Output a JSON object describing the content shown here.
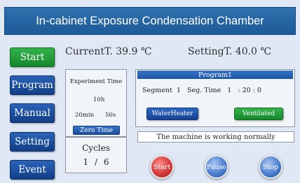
{
  "header": {
    "title": "In-cabinet Exposure Condensation Chamber"
  },
  "sidebar": {
    "items": [
      {
        "label": "Start",
        "color": "#22a33b"
      },
      {
        "label": "Program",
        "color": "#1a4fa0"
      },
      {
        "label": "Manual",
        "color": "#1a4fa0"
      },
      {
        "label": "Setting",
        "color": "#1a4fa0"
      },
      {
        "label": "Event",
        "color": "#1a4fa0"
      }
    ]
  },
  "status": {
    "current_label": "CurrentT.",
    "current_value": "39.9",
    "current_unit": "℃",
    "setting_label": "SettingT.",
    "setting_value": "40.0",
    "setting_unit": "℃"
  },
  "experiment": {
    "title": "Experiment Time",
    "hours": "10h",
    "minutes": "20min",
    "seconds": "50s",
    "zero_button": "Zero Time",
    "cycles_label": "Cycles",
    "cycles_current": "1",
    "cycles_sep": "/",
    "cycles_total": "6"
  },
  "program": {
    "title": "Program1",
    "segment_label": "Segment",
    "segment_value": "1",
    "seg_time_label": "Seg. Time",
    "seg_time_h": "1",
    "seg_time_sep1": ":",
    "seg_time_m": "20",
    "seg_time_sep2": ":",
    "seg_time_s": "0",
    "water_heater_label": "WaterHeater",
    "ventilated_label": "Ventilated"
  },
  "message": "The machine is working normally",
  "controls": {
    "start_label": "Start",
    "pause_label": "Pause",
    "stop_label": "Stop"
  },
  "colors": {
    "title_bar": "#2265a5",
    "active_green": "#22a33b",
    "button_blue": "#1a4fa0",
    "start_red": "#d33a3a",
    "control_blue": "#4c7fcf"
  }
}
